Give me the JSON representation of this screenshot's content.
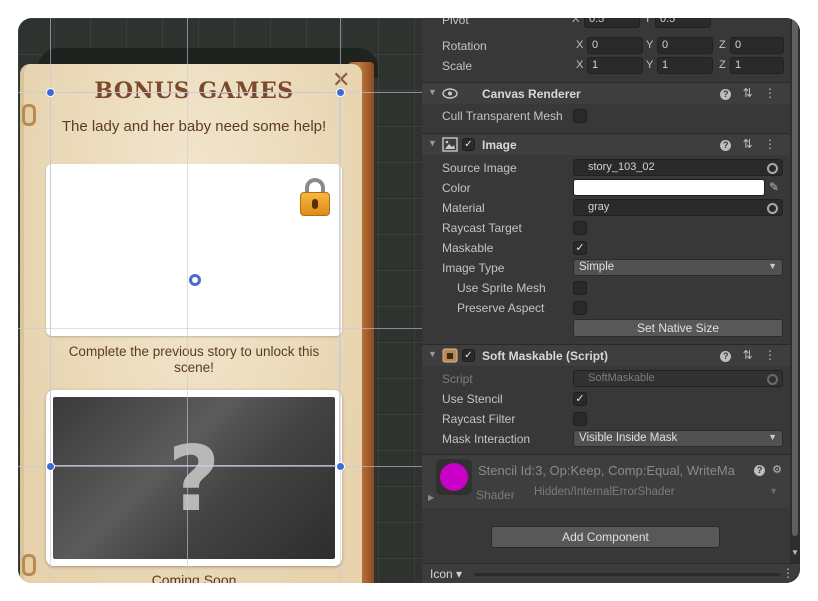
{
  "scene": {
    "title": "BONUS GAMES",
    "close_glyph": "✕",
    "subtitle": "The lady and her baby need some help!",
    "unlock_message": "Complete the previous story to unlock this scene!",
    "question_mark": "?",
    "coming_soon": "Coming Soon"
  },
  "inspector": {
    "pivot": {
      "label": "Pivot",
      "x_axis": "X",
      "x": "0.5",
      "y_axis": "Y",
      "y": "0.5"
    },
    "rotation": {
      "label": "Rotation",
      "x_axis": "X",
      "x": "0",
      "y_axis": "Y",
      "y": "0",
      "z_axis": "Z",
      "z": "0"
    },
    "scale": {
      "label": "Scale",
      "x_axis": "X",
      "x": "1",
      "y_axis": "Y",
      "y": "1",
      "z_axis": "Z",
      "z": "1"
    },
    "canvas_renderer": {
      "title": "Canvas Renderer",
      "cull_transparent_mesh_label": "Cull Transparent Mesh",
      "cull_transparent_mesh": false
    },
    "image": {
      "title": "Image",
      "enabled": true,
      "source_image_label": "Source Image",
      "source_image": "story_103_02",
      "color_label": "Color",
      "color": "#ffffff",
      "material_label": "Material",
      "material": "gray",
      "raycast_target_label": "Raycast Target",
      "raycast_target": false,
      "maskable_label": "Maskable",
      "maskable": true,
      "image_type_label": "Image Type",
      "image_type": "Simple",
      "use_sprite_mesh_label": "Use Sprite Mesh",
      "use_sprite_mesh": false,
      "preserve_aspect_label": "Preserve Aspect",
      "preserve_aspect": false,
      "set_native_size_label": "Set Native Size"
    },
    "soft_maskable": {
      "title": "Soft Maskable (Script)",
      "enabled": true,
      "script_label": "Script",
      "script": "SoftMaskable",
      "use_stencil_label": "Use Stencil",
      "use_stencil": true,
      "raycast_filter_label": "Raycast Filter",
      "raycast_filter": false,
      "mask_interaction_label": "Mask Interaction",
      "mask_interaction": "Visible Inside Mask"
    },
    "material_preview": {
      "name": "Stencil Id:3, Op:Keep, Comp:Equal, WriteMa",
      "shader_label": "Shader",
      "shader": "Hidden/InternalErrorShader",
      "swatch_color": "#c800c8"
    },
    "add_component_label": "Add Component",
    "bottom_bar": {
      "icon_label": "Icon ▾"
    }
  },
  "icons": {
    "help": "help-icon",
    "presets": "presets-icon",
    "menu": "kebab-menu-icon",
    "visibility": "eye-icon",
    "image_component": "image-component-icon",
    "script_component": "script-component-icon",
    "lock": "padlock-icon"
  }
}
